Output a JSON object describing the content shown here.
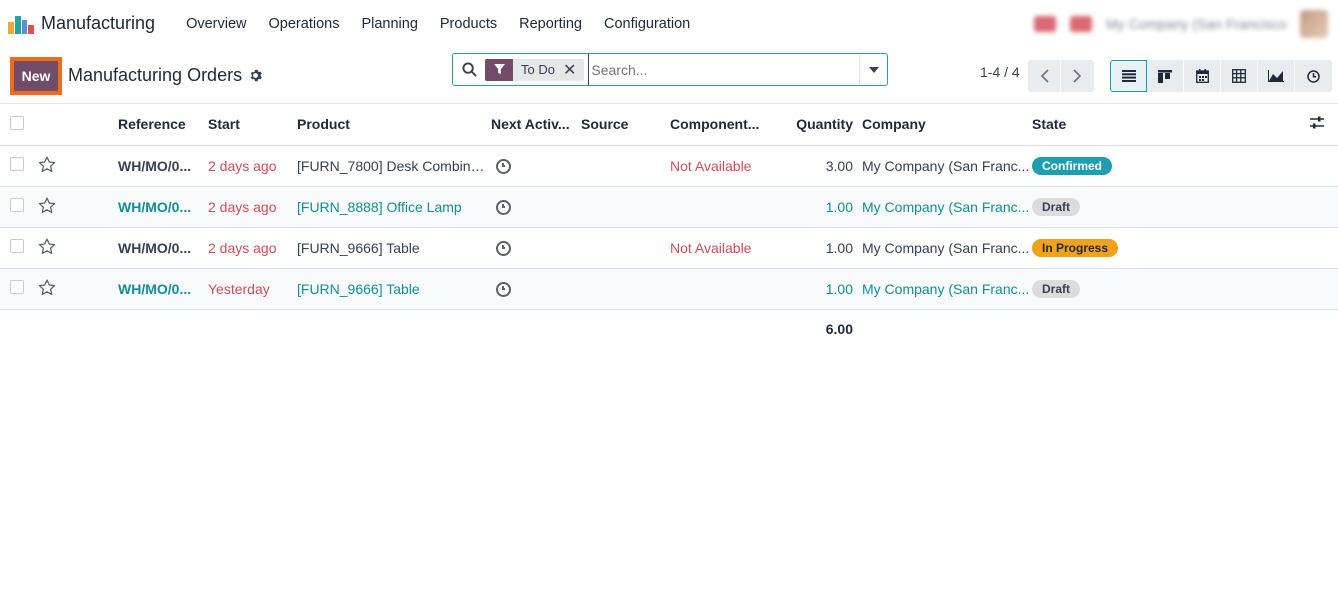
{
  "navbar": {
    "app_name": "Manufacturing",
    "menu": [
      "Overview",
      "Operations",
      "Planning",
      "Products",
      "Reporting",
      "Configuration"
    ],
    "company_switcher": "My Company (San Francisco)"
  },
  "control_panel": {
    "new_label": "New",
    "title": "Manufacturing Orders",
    "search": {
      "facet": "To Do",
      "placeholder": "Search..."
    },
    "pager": "1-4 / 4"
  },
  "table": {
    "columns": [
      "Reference",
      "Start",
      "Product",
      "Next Activ...",
      "Source",
      "Component...",
      "Quantity",
      "Company",
      "State"
    ],
    "rows": [
      {
        "reference": "WH/MO/0...",
        "start": "2 days ago",
        "product": "[FURN_7800] Desk Combina...",
        "source": "",
        "components": "Not Available",
        "quantity": "3.00",
        "company": "My Company (San Franc...",
        "state": "Confirmed",
        "state_kind": "confirmed"
      },
      {
        "reference": "WH/MO/0...",
        "start": "2 days ago",
        "product": "[FURN_8888] Office Lamp",
        "source": "",
        "components": "",
        "quantity": "1.00",
        "company": "My Company (San Franc...",
        "state": "Draft",
        "state_kind": "draft"
      },
      {
        "reference": "WH/MO/0...",
        "start": "2 days ago",
        "product": "[FURN_9666] Table",
        "source": "",
        "components": "Not Available",
        "quantity": "1.00",
        "company": "My Company (San Franc...",
        "state": "In Progress",
        "state_kind": "progress"
      },
      {
        "reference": "WH/MO/0...",
        "start": "Yesterday",
        "product": "[FURN_9666] Table",
        "source": "",
        "components": "",
        "quantity": "1.00",
        "company": "My Company (San Franc...",
        "state": "Draft",
        "state_kind": "draft"
      }
    ],
    "total_quantity": "6.00"
  }
}
